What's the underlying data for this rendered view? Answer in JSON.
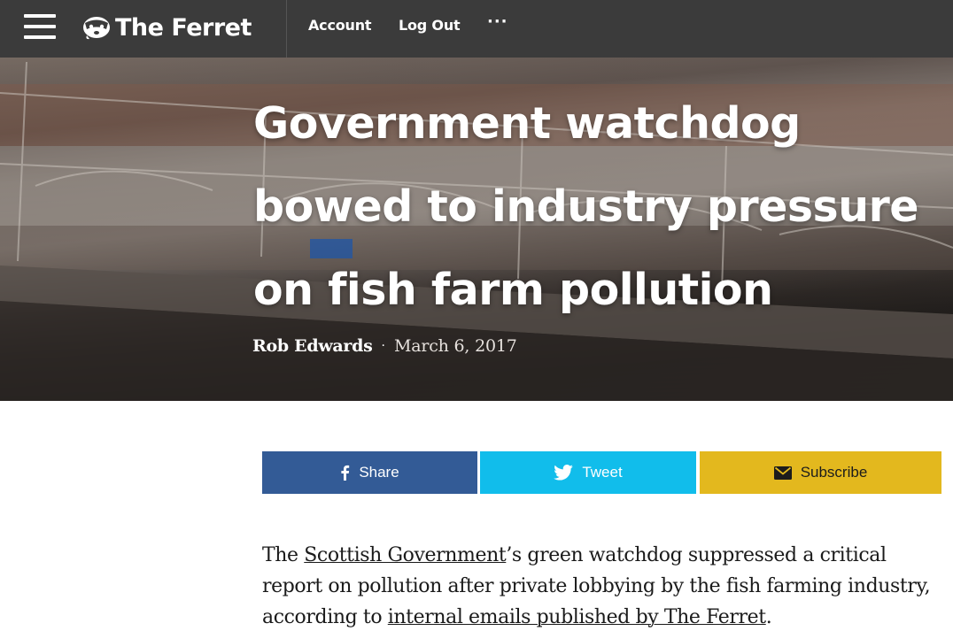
{
  "nav": {
    "brand": "The Ferret",
    "account_label": "Account",
    "logout_label": "Log Out",
    "more_label": "···"
  },
  "hero": {
    "title": "Government watchdog bowed to industry pressure on fish farm pollution",
    "author": "Rob Edwards",
    "separator": "·",
    "date": "March 6, 2017"
  },
  "share": {
    "share_label": "Share",
    "tweet_label": "Tweet",
    "subscribe_label": "Subscribe",
    "colors": {
      "facebook": "#335b96",
      "twitter": "#11bdeb",
      "subscribe": "#e3b81e"
    }
  },
  "article": {
    "p1_start": "The ",
    "p1_link1": "Scottish Government",
    "p1_mid": "’s green watchdog suppressed a critical report on pollution after private lobbying by the fish farming industry, according to ",
    "p1_link2": "internal emails published by The Ferret",
    "p1_end": "."
  }
}
